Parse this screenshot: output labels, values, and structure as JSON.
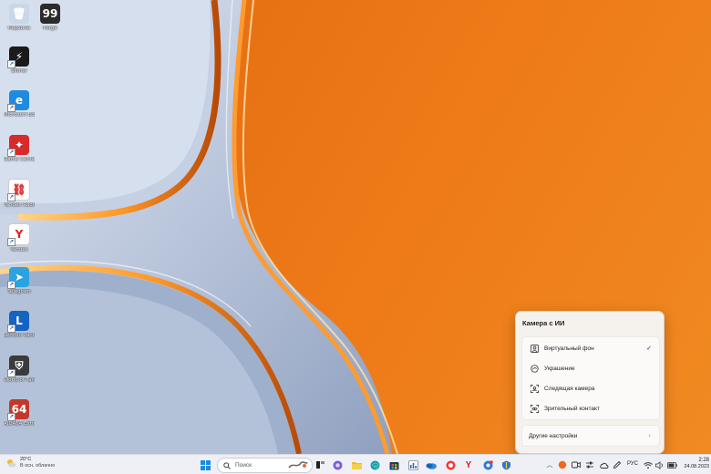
{
  "desktop": {
    "icons": [
      {
        "label": "Корзина",
        "color": "#c9d7e6",
        "glyph": "🗑"
      },
      {
        "label": "Forge",
        "color": "#2b2b2b",
        "glyph": "99"
      },
      {
        "label": "Slither",
        "color": "#1a1a1a",
        "glyph": "⚡"
      },
      {
        "label": "Microsoft Edge",
        "color": "#1f8be0",
        "glyph": "e"
      },
      {
        "label": "Game Center",
        "color": "#d72a2a",
        "glyph": "✦"
      },
      {
        "label": "Yandex Radio",
        "color": "#ffffff",
        "glyph": "⛓"
      },
      {
        "label": "Yandex",
        "color": "#ffffff",
        "glyph": "Y"
      },
      {
        "label": "Telegram",
        "color": "#2aa3e0",
        "glyph": "➤"
      },
      {
        "label": "Lenovo Vantage",
        "color": "#1565c0",
        "glyph": "L"
      },
      {
        "label": "World of Tanks",
        "color": "#3b3b3b",
        "glyph": "⛨"
      },
      {
        "label": "AIDA64 Extreme",
        "color": "#c0392b",
        "glyph": "64"
      }
    ]
  },
  "camera_flyout": {
    "title": "Камера с ИИ",
    "effects": [
      {
        "label": "Виртуальный фон",
        "icon": "person-background-icon",
        "checked": true
      },
      {
        "label": "Украшение",
        "icon": "beauty-icon",
        "checked": false
      },
      {
        "label": "Следящая камера",
        "icon": "tracking-camera-icon",
        "checked": false
      },
      {
        "label": "Зрительный контакт",
        "icon": "eye-contact-icon",
        "checked": false
      }
    ],
    "check_glyph": "✓",
    "more_settings": "Другие настройки",
    "more_chevron": "›"
  },
  "taskbar": {
    "weather": {
      "temp": "20°C",
      "condition": "В осн. облачно"
    },
    "search_placeholder": "Поиск",
    "apps": [
      "start-icon",
      "search-icon",
      "widgets-icon",
      "terminal-icon",
      "copilot-icon",
      "file-explorer-icon",
      "edge-icon",
      "store-icon",
      "xbox-icon",
      "onedrive-icon",
      "yandex-browser-icon",
      "yandex-icon",
      "camera-app-icon",
      "defender-icon"
    ],
    "tray": {
      "language": "РУС",
      "time": "2:28",
      "date": "24.08.2023"
    }
  },
  "colors": {
    "accent": "#e8781a",
    "taskbar_bg": "#eef0f6",
    "flyout_bg": "#f5f2ee"
  }
}
